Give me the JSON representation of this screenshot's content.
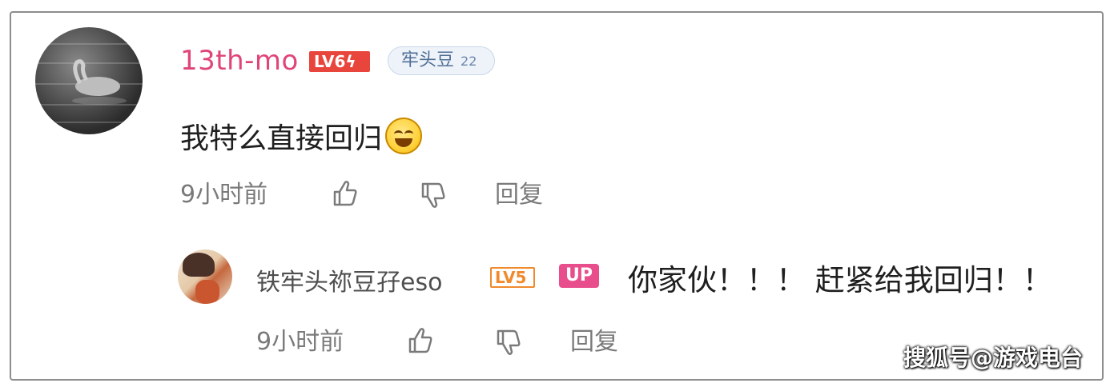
{
  "comment": {
    "username": "13th-mo",
    "level_badge": "LV6",
    "level_bolt": "ϟ",
    "fan_badge_name": "牢头豆",
    "fan_badge_level": "22",
    "text": "我特么直接回归",
    "emoji": "grinning-face",
    "time": "9小时前",
    "reply_label": "回复"
  },
  "reply": {
    "username": "铁牢头祢豆孖eso",
    "level_badge": "LV5",
    "up_badge": "UP",
    "text": "你家伙！！！ 赶紧给我回归！！",
    "time": "9小时前",
    "reply_label": "回复"
  },
  "watermark": "搜狐号@游戏电台",
  "colors": {
    "username_main": "#e0457a",
    "lv6": "#e8463c",
    "lv5": "#f08a2c",
    "up_badge": "#e94e8c",
    "meta_text": "#7a7a7a"
  }
}
